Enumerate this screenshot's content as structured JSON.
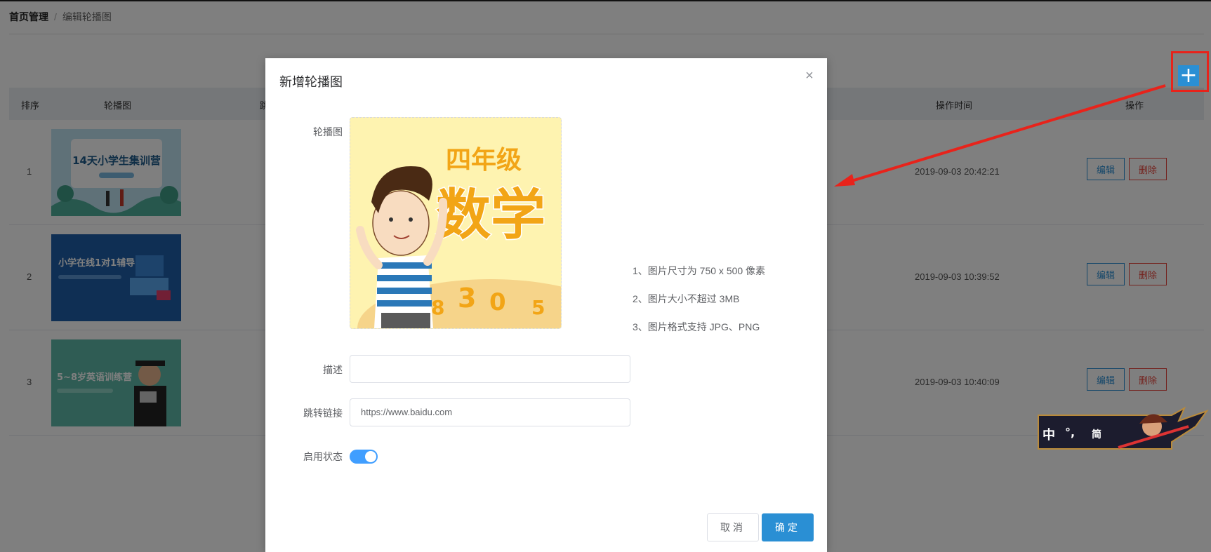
{
  "breadcrumb": {
    "home": "首页管理",
    "separator": "/",
    "current": "编辑轮播图"
  },
  "toolbar": {
    "add_symbol": "+"
  },
  "table": {
    "headers": {
      "order": "排序",
      "image": "轮播图",
      "col3": "跳",
      "time": "操作时间",
      "ops": "操作"
    },
    "rows": [
      {
        "order": "1",
        "time": "2019-09-03 20:42:21",
        "edit": "编辑",
        "delete": "删除",
        "thumb": {
          "title": "14天小学生集训营",
          "bg": "#bfe3f0"
        }
      },
      {
        "order": "2",
        "time": "2019-09-03 10:39:52",
        "edit": "编辑",
        "delete": "删除",
        "thumb": {
          "title": "小学在线1对1辅导",
          "bg": "#1e5fa8"
        }
      },
      {
        "order": "3",
        "time": "2019-09-03 10:40:09",
        "edit": "编辑",
        "delete": "删除",
        "thumb": {
          "title": "5~8岁英语训练营",
          "bg": "#5fb8a8"
        }
      }
    ]
  },
  "modal": {
    "title": "新增轮播图",
    "close_symbol": "×",
    "labels": {
      "image": "轮播图",
      "desc": "描述",
      "link": "跳转链接",
      "status": "启用状态"
    },
    "upload_preview": {
      "grade": "四年级",
      "subject": "数学",
      "digits": [
        "8",
        "3",
        "0",
        "5"
      ]
    },
    "tips": [
      "1、图片尺寸为 750 x 500 像素",
      "2、图片大小不超过 3MB",
      "3、图片格式支持 JPG、PNG"
    ],
    "desc_value": "",
    "link_value": "https://www.baidu.com",
    "status_enabled": true,
    "cancel": "取消",
    "ok": "确定"
  },
  "ime": {
    "label": "中",
    "punct": "°,",
    "mode": "简"
  },
  "colors": {
    "primary": "#2a8fd4",
    "danger": "#e8453c",
    "arrow": "#e8231b",
    "switch": "#409eff"
  }
}
